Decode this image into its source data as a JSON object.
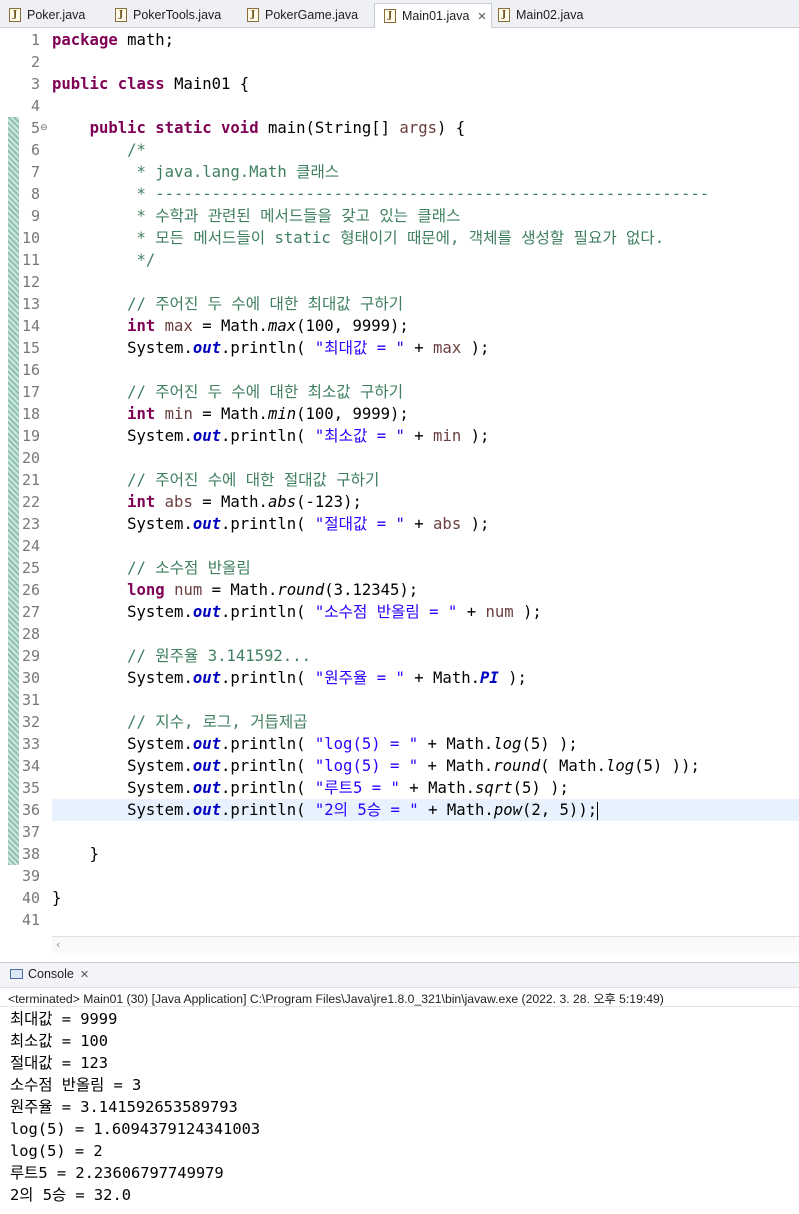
{
  "tabs": [
    {
      "label": "Poker.java",
      "active": false
    },
    {
      "label": "PokerTools.java",
      "active": false
    },
    {
      "label": "PokerGame.java",
      "active": false
    },
    {
      "label": "Main01.java",
      "active": true
    },
    {
      "label": "Main02.java",
      "active": false
    }
  ],
  "editor": {
    "line_numbers": [
      "1",
      "2",
      "3",
      "4",
      "5",
      "6",
      "7",
      "8",
      "9",
      "10",
      "11",
      "12",
      "13",
      "14",
      "15",
      "16",
      "17",
      "18",
      "19",
      "20",
      "21",
      "22",
      "23",
      "24",
      "25",
      "26",
      "27",
      "28",
      "29",
      "30",
      "31",
      "32",
      "33",
      "34",
      "35",
      "36",
      "37",
      "38",
      "39",
      "40",
      "41"
    ],
    "code": {
      "l1_kw": "package",
      "l1_rest": " math;",
      "l3_kw1": "public",
      "l3_kw2": "class",
      "l3_rest": " Main01 {",
      "l5_kw1": "public",
      "l5_kw2": "static",
      "l5_kw3": "void",
      "l5_rest": " main(String[] ",
      "l5_arg": "args",
      "l5_end": ") {",
      "l6": "/*",
      "l7": " * java.lang.Math 클래스",
      "l8": " * -----------------------------------------------------------",
      "l9": " * 수학과 관련된 메서드들을 갖고 있는 클래스",
      "l10": " * 모든 메서드들이 static 형태이기 때문에, 객체를 생성할 필요가 없다.",
      "l11": " */",
      "l13": "// 주어진 두 수에 대한 최대값 구하기",
      "l14_kw": "int",
      "l14_var": "max",
      "l14_a": " = Math.",
      "l14_m": "max",
      "l14_b": "(100, 9999);",
      "sys": "System.",
      "out": "out",
      "println": ".println( ",
      "l15_str": "\"최대값 = \"",
      "l15_b": " + ",
      "l15_var": "max",
      "l15_c": " );",
      "l17": "// 주어진 두 수에 대한 최소값 구하기",
      "l18_kw": "int",
      "l18_var": "min",
      "l18_a": " = Math.",
      "l18_m": "min",
      "l18_b": "(100, 9999);",
      "l19_str": "\"최소값 = \"",
      "l19_var": "min",
      "l21": "// 주어진 수에 대한 절대값 구하기",
      "l22_kw": "int",
      "l22_var": "abs",
      "l22_a": " = Math.",
      "l22_m": "abs",
      "l22_b": "(-123);",
      "l23_str": "\"절대값 = \"",
      "l23_var": "abs",
      "l25": "// 소수점 반올림",
      "l26_kw": "long",
      "l26_var": "num",
      "l26_a": " = Math.",
      "l26_m": "round",
      "l26_b": "(3.12345);",
      "l27_str": "\"소수점 반올림 = \"",
      "l27_var": "num",
      "l29": "// 원주율 3.141592...",
      "l30_str": "\"원주율 = \"",
      "l30_a": " + Math.",
      "l30_f": "PI",
      "l30_b": " );",
      "l32": "// 지수, 로그, 거듭제곱",
      "l33_str": "\"log(5) = \"",
      "l33_a": " + Math.",
      "l33_m": "log",
      "l33_b": "(5) );",
      "l34_str": "\"log(5) = \"",
      "l34_a": " + Math.",
      "l34_m": "round",
      "l34_b": "( Math.",
      "l34_m2": "log",
      "l34_c": "(5) ));",
      "l35_str": "\"루트5 = \"",
      "l35_a": " + Math.",
      "l35_m": "sqrt",
      "l35_b": "(5) );",
      "l36_str": "\"2의 5승 = \"",
      "l36_a": " + Math.",
      "l36_m": "pow",
      "l36_b": "(2, 5));",
      "l38": "}",
      "l40": "}"
    }
  },
  "console": {
    "tab_label": "Console",
    "info": "<terminated> Main01 (30) [Java Application] C:\\Program Files\\Java\\jre1.8.0_321\\bin\\javaw.exe  (2022. 3. 28. 오후 5:19:49)",
    "lines": [
      "최대값 = 9999",
      "최소값 = 100",
      "절대값 = 123",
      "소수점 반올림 = 3",
      "원주율 = 3.141592653589793",
      "log(5) = 1.6094379124341003",
      "log(5) = 2",
      "루트5 = 2.23606797749979",
      "2의 5승 = 32.0"
    ]
  },
  "colors": {
    "keyword": "#7f0055",
    "comment": "#3f7f5f",
    "string": "#2a00ff",
    "field": "#0000c0",
    "current_line": "#e8f2fe"
  }
}
